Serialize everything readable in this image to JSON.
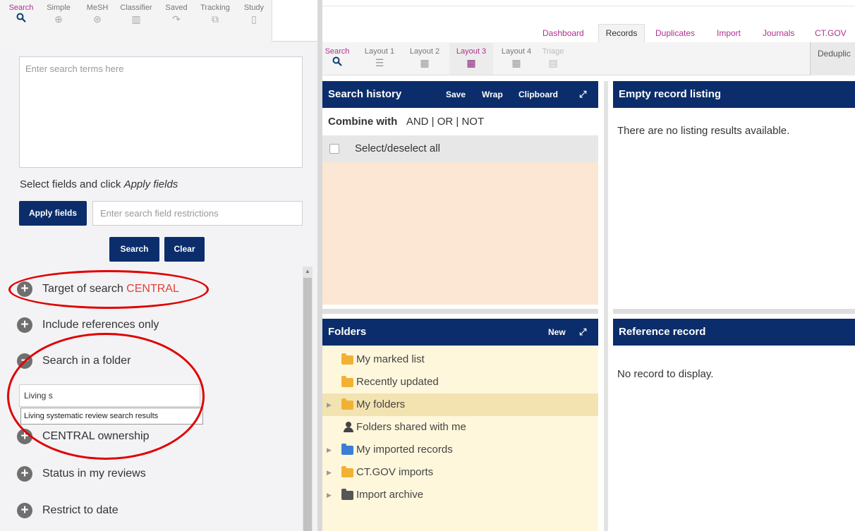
{
  "left_tabs": [
    {
      "label": "Search",
      "icon": "search-icon"
    },
    {
      "label": "Simple",
      "icon": "zoom-icon"
    },
    {
      "label": "MeSH",
      "icon": "mesh-icon"
    },
    {
      "label": "Classifier",
      "icon": "chart-icon"
    },
    {
      "label": "Saved",
      "icon": "redo-arrow-icon"
    },
    {
      "label": "Tracking",
      "icon": "tracking-icon"
    },
    {
      "label": "Study",
      "icon": "document-icon"
    }
  ],
  "search_box": {
    "placeholder": "Enter search terms here"
  },
  "fields": {
    "hint_prefix": "Select fields and click ",
    "hint_italic": "Apply fields",
    "apply_label": "Apply fields",
    "restriction_placeholder": "Enter search field restrictions"
  },
  "actions": {
    "search_label": "Search",
    "clear_label": "Clear"
  },
  "options": {
    "target_label": "Target of search ",
    "target_value": "CENTRAL",
    "include_refs": "Include references only",
    "search_folder": "Search in a folder",
    "folder_input_value": "Living s",
    "folder_suggestion": "Living systematic review search results",
    "ownership": "CENTRAL ownership",
    "status": "Status in my reviews",
    "restrict_date": "Restrict to date"
  },
  "top_nav": {
    "dashboard": "Dashboard",
    "records": "Records",
    "duplicates": "Duplicates",
    "import": "Import",
    "journals": "Journals",
    "ctgov": "CT.GOV"
  },
  "layout_tabs": [
    {
      "label": "Search"
    },
    {
      "label": "Layout 1"
    },
    {
      "label": "Layout 2"
    },
    {
      "label": "Layout 3"
    },
    {
      "label": "Layout 4"
    },
    {
      "label": "Triage"
    }
  ],
  "dedup_label": "Deduplic",
  "search_history": {
    "title": "Search history",
    "save": "Save",
    "wrap": "Wrap",
    "clipboard": "Clipboard",
    "combine_label": "Combine with",
    "combine_ops": "AND | OR | NOT",
    "select_all": "Select/deselect all"
  },
  "folders": {
    "title": "Folders",
    "new": "New",
    "items": [
      {
        "label": "My marked list",
        "color": "#f2b134"
      },
      {
        "label": "Recently updated",
        "color": "#f2b134"
      },
      {
        "label": "My folders",
        "color": "#f2b134"
      },
      {
        "label": "Folders shared with me",
        "color": "#444444"
      },
      {
        "label": "My imported records",
        "color": "#3a7fd5"
      },
      {
        "label": "CT.GOV imports",
        "color": "#f2b134"
      },
      {
        "label": "Import archive",
        "color": "#555555"
      }
    ]
  },
  "empty_listing": {
    "title": "Empty record listing",
    "message": "There are no listing results available."
  },
  "reference_record": {
    "title": "Reference record",
    "message": "No record to display."
  },
  "colors": {
    "navy": "#0b2d6b",
    "magenta": "#b0308f",
    "highlight": "#e00000"
  }
}
